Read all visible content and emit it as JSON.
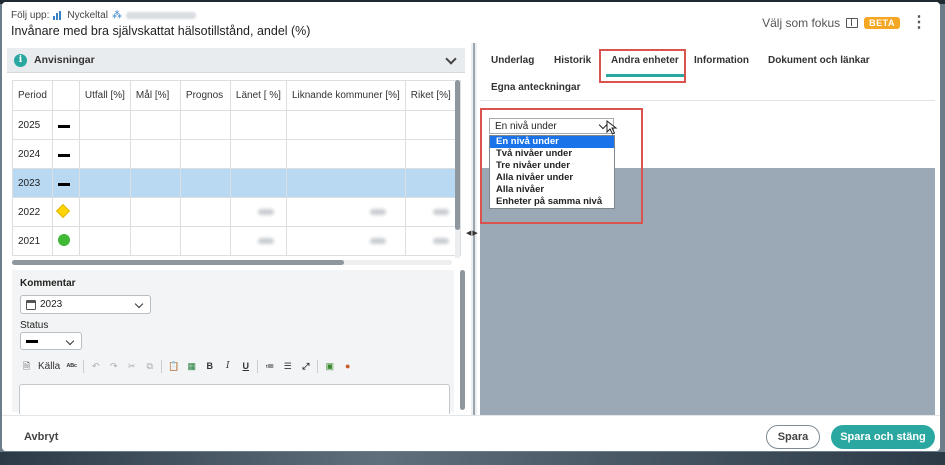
{
  "header": {
    "follow_label": "Följ upp:",
    "kpi_type": "Nyckeltal",
    "title": "Invånare med bra självskattat hälsotillstånd, andel (%)",
    "focus_label": "Välj som fokus",
    "beta_label": "BETA"
  },
  "instructions": {
    "label": "Anvisningar"
  },
  "table": {
    "columns": [
      "Period",
      "",
      "Utfall [%]",
      "Mål [%]",
      "Prognos",
      "Länet [ %]",
      "Liknande kommuner [%]",
      "Riket [%]"
    ],
    "rows": [
      {
        "period": "2025",
        "status": "dash",
        "selected": false
      },
      {
        "period": "2024",
        "status": "dash",
        "selected": false
      },
      {
        "period": "2023",
        "status": "dash",
        "selected": true
      },
      {
        "period": "2022",
        "status": "yellow-diamond",
        "selected": false
      },
      {
        "period": "2021",
        "status": "green-circle",
        "selected": false
      }
    ]
  },
  "comment": {
    "label": "Kommentar",
    "year_value": "2023",
    "status_label": "Status",
    "toolbar_source": "Källa"
  },
  "tabs": {
    "items": [
      "Underlag",
      "Historik",
      "Andra enheter",
      "Information",
      "Dokument och länkar",
      "Egna anteckningar"
    ],
    "active": "Andra enheter"
  },
  "level_select": {
    "value": "En nivå under",
    "options": [
      "En nivå under",
      "Två nivåer under",
      "Tre nivåer under",
      "Alla nivåer under",
      "Alla nivåer",
      "Enheter på samma nivå"
    ]
  },
  "footer": {
    "cancel": "Avbryt",
    "save": "Spara",
    "save_close": "Spara och stäng"
  },
  "colors": {
    "accent": "#2aa7a0",
    "selected_row": "#b9d9f3",
    "highlight": "#d9534f",
    "beta": "#f5a623"
  }
}
